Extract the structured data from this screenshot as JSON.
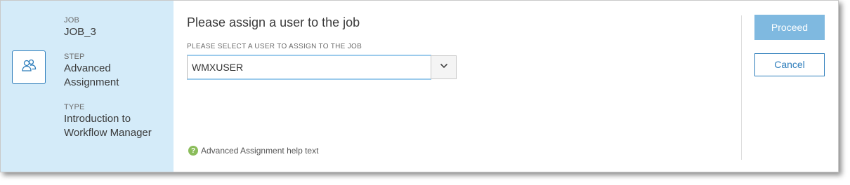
{
  "sidebar": {
    "step_icon": "users-icon",
    "job_label": "JOB",
    "job_value": "JOB_3",
    "step_label": "STEP",
    "step_value_line1": "Advanced",
    "step_value_line2": "Assignment",
    "type_label": "TYPE",
    "type_value_line1": "Introduction to",
    "type_value_line2": "Workflow Manager"
  },
  "main": {
    "title": "Please assign a user to the job",
    "field_label": "PLEASE SELECT A USER TO ASSIGN TO THE JOB",
    "selected_user": "WMXUSER",
    "dropdown_icon": "chevron-down-icon",
    "help_icon": "question-icon",
    "help_text": "Advanced Assignment help text"
  },
  "actions": {
    "proceed_label": "Proceed",
    "cancel_label": "Cancel"
  },
  "colors": {
    "sidebar_bg": "#d4ebf9",
    "accent": "#2d7dbb",
    "proceed_bg": "#7fb9e0",
    "help_icon_bg": "#8bbd5b"
  }
}
